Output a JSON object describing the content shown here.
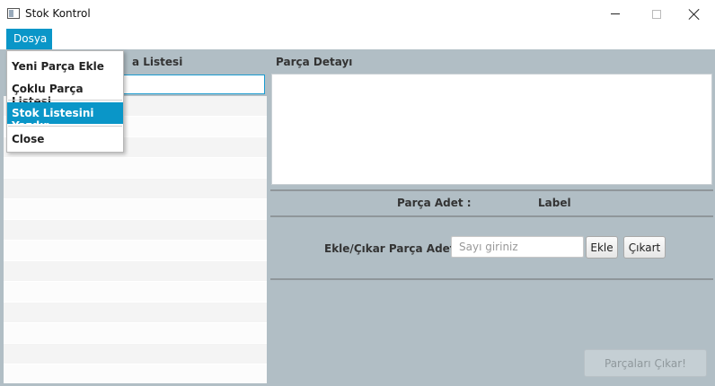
{
  "window": {
    "title": "Stok Kontrol",
    "icon": "app-window-icon"
  },
  "menubar": {
    "dosya_label": "Dosya"
  },
  "dropdown": {
    "items": [
      "Yeni Parça Ekle",
      "Çoklu Parça Listesi",
      "Stok Listesini Yazdır",
      "Close"
    ]
  },
  "left_panel": {
    "title_visible": "a Listesi",
    "search_value": "",
    "rows": 14
  },
  "detail_panel": {
    "title": "Parça Detayı",
    "adet_label": "Parça Adet :",
    "adet_value": "Label",
    "ekle_cikar_label": "Ekle/Çıkar Parça Adet :",
    "input_placeholder": "Sayı giriniz",
    "ekle_button": "Ekle",
    "cikart_button": "Çıkart",
    "cikar_all_button": "Parçaları Çıkar!"
  },
  "colors": {
    "accent": "#0a96c8",
    "background": "#b1bec5"
  }
}
